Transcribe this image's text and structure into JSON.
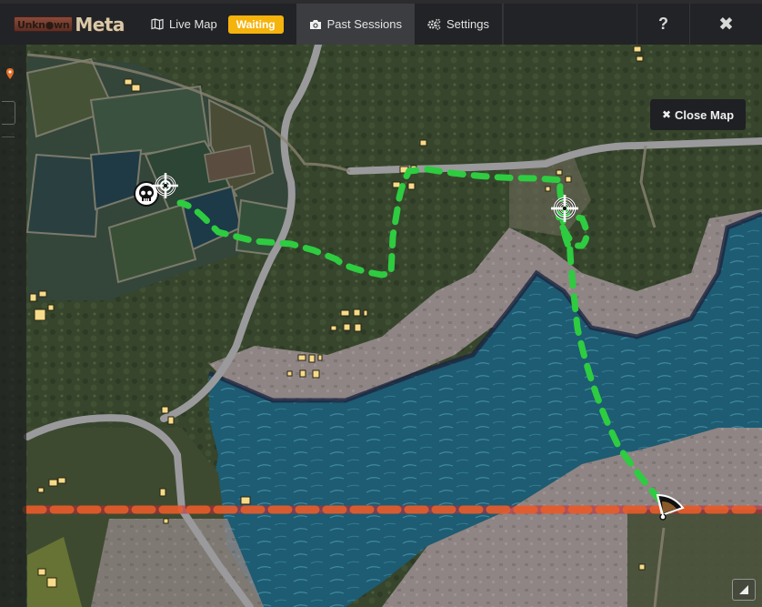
{
  "app": {
    "logo_part1": "Unkn●wn",
    "logo_part2": "Meta"
  },
  "nav": {
    "live_map": {
      "label": "Live Map",
      "icon": "map-icon"
    },
    "status_badge": {
      "label": "Waiting",
      "color": "#f5b30d"
    },
    "past_sessions": {
      "label": "Past Sessions",
      "icon": "camera-icon",
      "active": true
    },
    "settings": {
      "label": "Settings",
      "icon": "cogs-icon"
    },
    "help": {
      "label": "?",
      "icon": "question-icon"
    },
    "close": {
      "label": "✖",
      "icon": "close-icon"
    }
  },
  "map": {
    "close_map": {
      "label": "Close Map",
      "icon_glyph": "✖"
    },
    "path_color": "#2ecc40",
    "flight_path_color": "#e8602a",
    "markers": [
      {
        "type": "death",
        "icon": "skull-icon"
      },
      {
        "type": "kill",
        "icon": "crosshair-icon"
      },
      {
        "type": "kill",
        "icon": "crosshair-icon"
      },
      {
        "type": "landing",
        "icon": "parachute-icon"
      }
    ]
  }
}
